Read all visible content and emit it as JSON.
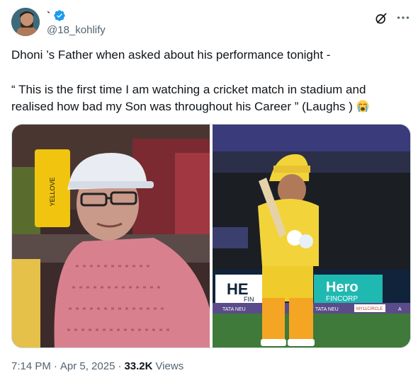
{
  "header": {
    "display_name": "`",
    "handle": "@18_kohlify",
    "verified": true,
    "verified_color": "#1d9bf0",
    "icons": [
      "grok-icon",
      "more-icon"
    ]
  },
  "tweet": {
    "line1": "Dhoni ’s Father when asked about his performance tonight -",
    "quote": "“ This is the first time I am watching a cricket match in stadium and realised how bad my Son was throughout his Career ” (Laughs )",
    "quote_emoji": "loudly-crying-face"
  },
  "media": {
    "left_image": {
      "description_icon": "photo",
      "banner_text": "YELLOVE"
    },
    "right_image": {
      "board_left": "HE",
      "board_left_sub": "FIN",
      "hero_brand": "Hero",
      "hero_sub": "FINCORP",
      "tata_left": "TATA NEU",
      "tata_mid": "TATA NEU",
      "myrcircle": "MY11CIRCLE",
      "a_label": "A"
    }
  },
  "meta": {
    "time": "7:14 PM",
    "sep1": "·",
    "date": "Apr 5, 2025",
    "sep2": "·",
    "views_count": "33.2K",
    "views_label": "Views"
  },
  "colors": {
    "text_primary": "#0f1419",
    "text_secondary": "#536471",
    "border": "#cfd9de",
    "csk_yellow": "#f2d43a",
    "hero_teal": "#1fb9b1"
  }
}
